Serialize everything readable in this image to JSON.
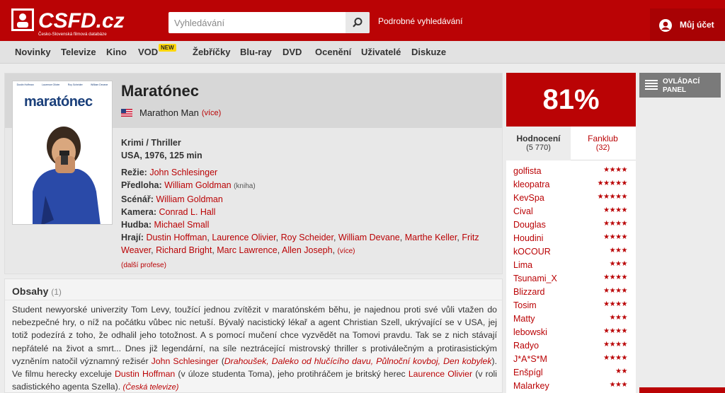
{
  "header": {
    "logo_text": "CSFD.cz",
    "logo_sub": "Česko-Slovenská filmová databáze",
    "search_placeholder": "Vyhledávání",
    "advanced_search": "Podrobné vyhledávání",
    "account": "Můj účet",
    "brand_color": "#ba0305"
  },
  "nav": {
    "items": [
      "Novinky",
      "Televize",
      "Kino",
      "VOD",
      "Žebříčky",
      "Blu-ray",
      "DVD",
      "Ocenění",
      "Uživatelé",
      "Diskuze"
    ],
    "new_badge": "NEW"
  },
  "film": {
    "poster_title": "maratónec",
    "poster_cast": [
      "Dustin Hoffman",
      "Laurence Olivier",
      "Roy Scheider",
      "William Devane"
    ],
    "title": "Maratónec",
    "original_title": "Marathon Man",
    "original_more": "(více)",
    "genres": "Krimi / Thriller",
    "origin": "USA, 1976, 125 min",
    "director_label": "Režie:",
    "director": "John Schlesinger",
    "source_label": "Předloha:",
    "source": "William Goldman",
    "source_note": "(kniha)",
    "screenplay_label": "Scénář:",
    "screenplay": "William Goldman",
    "camera_label": "Kamera:",
    "camera": "Conrad L. Hall",
    "music_label": "Hudba:",
    "music": "Michael Small",
    "cast_label": "Hrají:",
    "cast": [
      "Dustin Hoffman",
      "Laurence Olivier",
      "Roy Scheider",
      "William Devane",
      "Marthe Keller",
      "Fritz Weaver",
      "Richard Bright",
      "Marc Lawrence",
      "Allen Joseph"
    ],
    "cast_more": "(více)",
    "more_professions": "(další profese)"
  },
  "plot": {
    "title": "Obsahy",
    "count": "(1)",
    "p1": "Student newyorské univerzity Tom Levy, toužící jednou zvítězit v maratónském běhu, je najednou proti své vůli vtažen do nebezpečné hry, o níž na počátku vůbec nic netuší. Bývalý nacistický lékař a agent Christian Szell, ukrývající se v USA, jej totiž podezírá z toho, že odhalil jeho totožnost. A s pomocí mučení chce vyzvědět na Tomovi pravdu. Tak se z nich stávají nepřátelé na život a smrt... Dnes již legendární, na síle neztrácející mistrovský thriller s protiválečným a protirasistickým vyzněním natočil významný režisér ",
    "director": "John Schlesinger",
    "p2": " (",
    "films": "Drahoušek, Daleko od hlučícího davu, Půlnoční kovboj, Den kobylek",
    "p3": "). Ve filmu herecky exceluje ",
    "actor1": "Dustin Hoffman",
    "p4": " (v úloze studenta Toma), jeho protihráčem je britský herec ",
    "actor2": "Laurence Olivier",
    "p5": " (v roli sadistického agenta Szella). ",
    "source": "(Česká televize)"
  },
  "rating": {
    "score": "81%",
    "tab_ratings": "Hodnocení",
    "tab_ratings_count": "(5 770)",
    "tab_fanclub": "Fanklub",
    "tab_fanclub_count": "(32)",
    "users": [
      {
        "name": "golfista",
        "stars": "★★★★"
      },
      {
        "name": "kleopatra",
        "stars": "★★★★★"
      },
      {
        "name": "KevSpa",
        "stars": "★★★★★"
      },
      {
        "name": "Cival",
        "stars": "★★★★"
      },
      {
        "name": "Douglas",
        "stars": "★★★★"
      },
      {
        "name": "Houdini",
        "stars": "★★★★"
      },
      {
        "name": "kOCOUR",
        "stars": "★★★"
      },
      {
        "name": "Lima",
        "stars": "★★★"
      },
      {
        "name": "Tsunami_X",
        "stars": "★★★★"
      },
      {
        "name": "Blizzard",
        "stars": "★★★★"
      },
      {
        "name": "Tosim",
        "stars": "★★★★"
      },
      {
        "name": "Matty",
        "stars": "★★★"
      },
      {
        "name": "lebowski",
        "stars": "★★★★"
      },
      {
        "name": "Radyo",
        "stars": "★★★★"
      },
      {
        "name": "J*A*S*M",
        "stars": "★★★★"
      },
      {
        "name": "Enšpígl",
        "stars": "★★"
      },
      {
        "name": "Malarkey",
        "stars": "★★★"
      }
    ]
  },
  "control_panel": {
    "line1": "OVLÁDACÍ",
    "line2": "PANEL"
  }
}
